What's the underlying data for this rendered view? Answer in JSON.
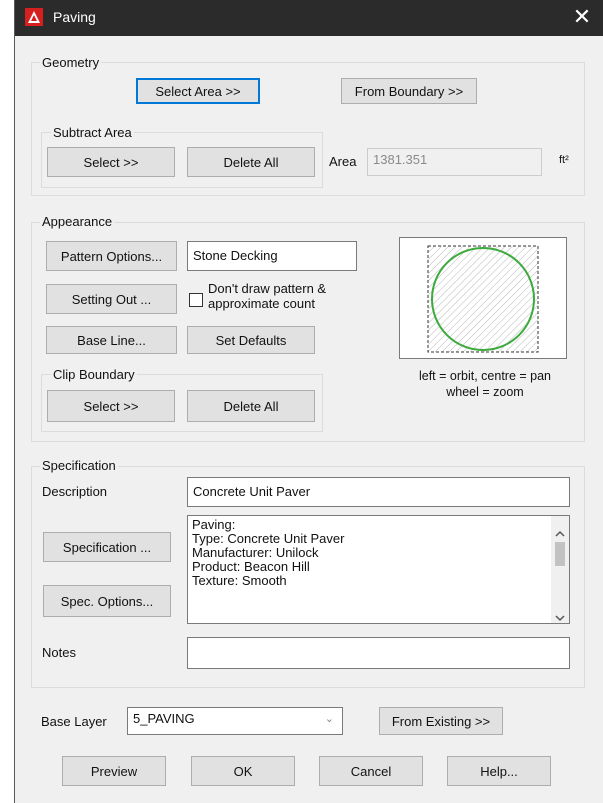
{
  "window": {
    "title": "Paving",
    "close_glyph": "✕"
  },
  "geometry": {
    "group_label": "Geometry",
    "select_area": "Select Area >>",
    "from_boundary": "From Boundary >>",
    "subtract_label": "Subtract Area",
    "subtract_select": "Select >>",
    "subtract_delete": "Delete All",
    "area_label": "Area",
    "area_value": "1381.351",
    "area_unit": "ft²"
  },
  "appearance": {
    "group_label": "Appearance",
    "pattern_options": "Pattern Options...",
    "pattern_name": "Stone Decking",
    "setting_out": "Setting Out ...",
    "dont_draw_label": "Don't draw pattern &\napproximate count",
    "dont_draw_checked": false,
    "base_line": "Base Line...",
    "set_defaults": "Set Defaults",
    "clip_label": "Clip Boundary",
    "clip_select": "Select >>",
    "clip_delete": "Delete All",
    "preview_hint": "left = orbit, centre = pan\nwheel = zoom"
  },
  "specification": {
    "group_label": "Specification",
    "description_label": "Description",
    "description_value": "Concrete Unit Paver",
    "specification_button": "Specification ...",
    "spec_options_button": "Spec. Options...",
    "spec_lines": [
      "Paving:",
      "Type: Concrete Unit Paver",
      "Manufacturer: Unilock",
      "Product: Beacon Hill",
      "Texture: Smooth"
    ],
    "notes_label": "Notes",
    "notes_value": ""
  },
  "footer": {
    "base_layer_label": "Base Layer",
    "base_layer_value": "5_PAVING",
    "from_existing": "From Existing >>",
    "preview": "Preview",
    "ok": "OK",
    "cancel": "Cancel",
    "help": "Help..."
  },
  "colors": {
    "title_bar": "#2b2b2b",
    "preview_circle": "#3caa3c",
    "app_icon": "#d62020"
  }
}
